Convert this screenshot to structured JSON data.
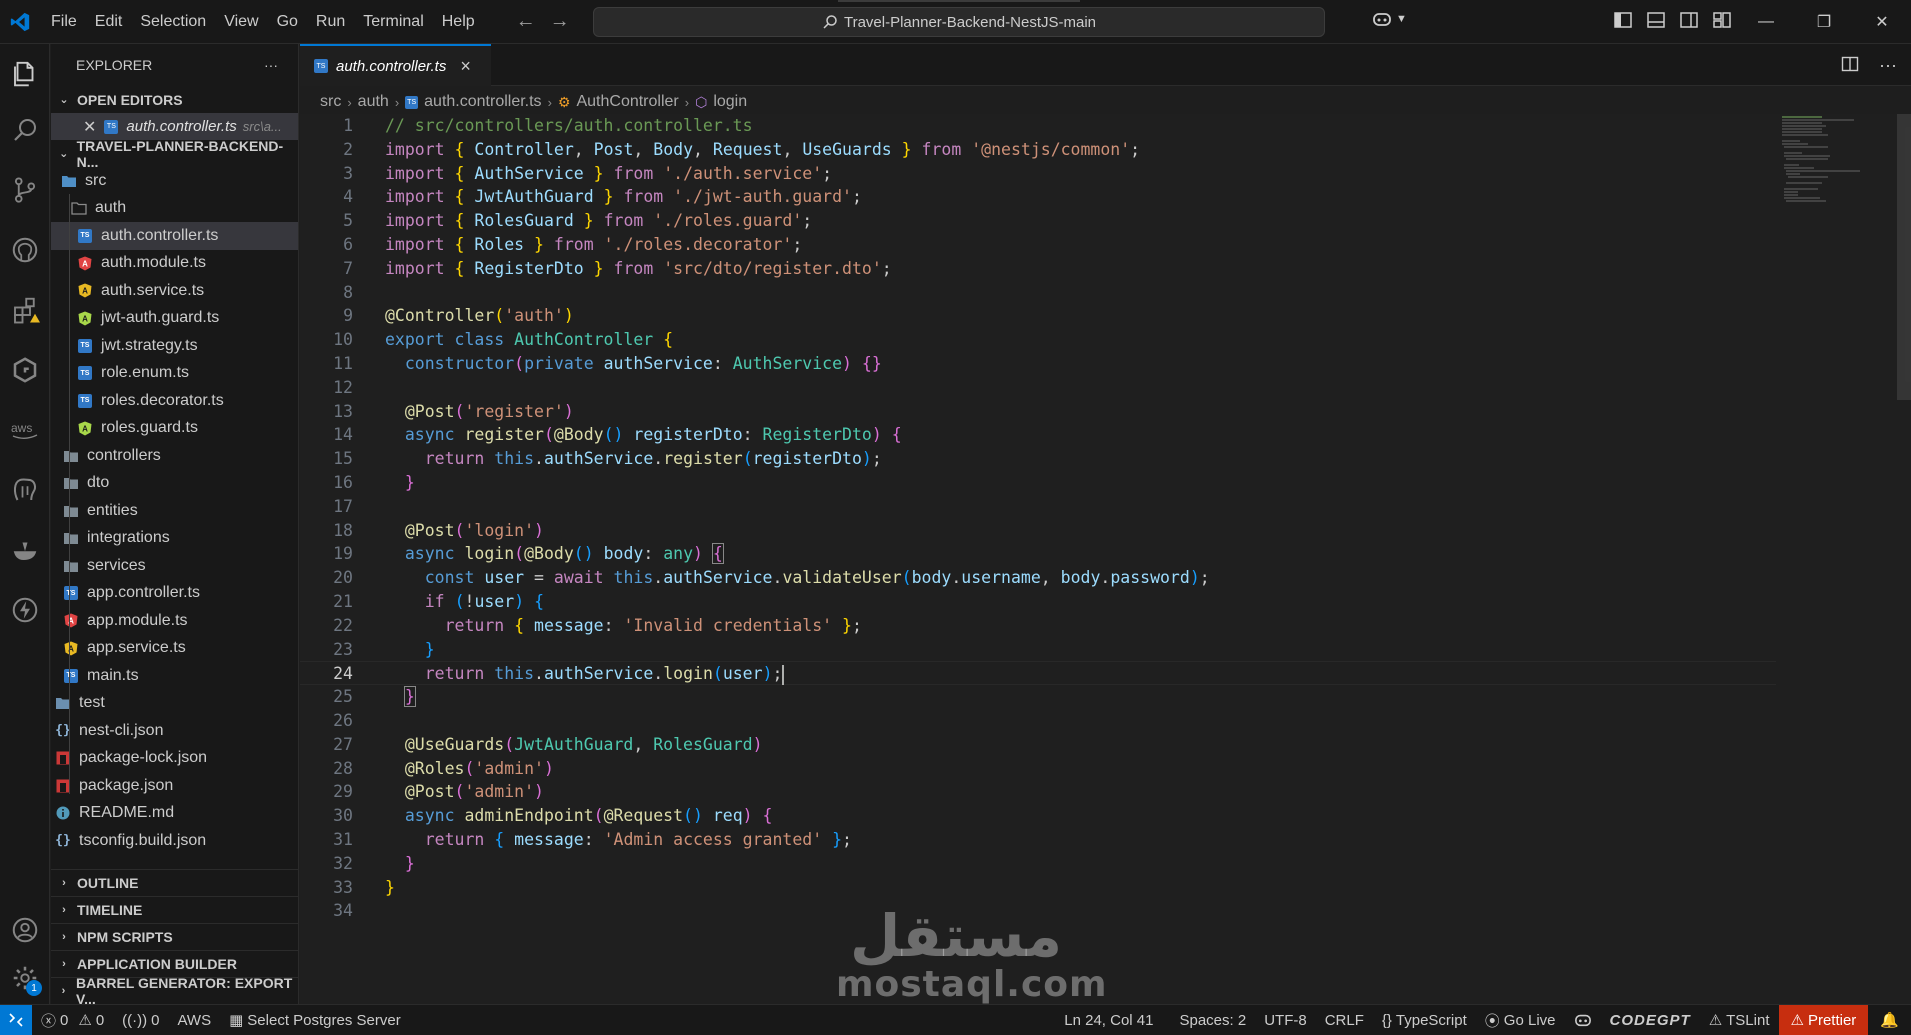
{
  "menu": [
    "File",
    "Edit",
    "Selection",
    "View",
    "Go",
    "Run",
    "Terminal",
    "Help"
  ],
  "search": {
    "text": "Travel-Planner-Backend-NestJS-main"
  },
  "explorer": {
    "title": "EXPLORER",
    "more": "···",
    "open_editors_label": "OPEN EDITORS",
    "open_editor": {
      "name": "auth.controller.ts",
      "path": "src\\a..."
    },
    "project_label": "TRAVEL-PLANNER-BACKEND-N...",
    "tree": [
      {
        "name": "src",
        "icon": "folder-src"
      },
      {
        "name": "auth",
        "icon": "folder-open"
      },
      {
        "name": "auth.controller.ts",
        "icon": "ts",
        "selected": true
      },
      {
        "name": "auth.module.ts",
        "icon": "angular"
      },
      {
        "name": "auth.service.ts",
        "icon": "angular-service"
      },
      {
        "name": "jwt-auth.guard.ts",
        "icon": "guard"
      },
      {
        "name": "jwt.strategy.ts",
        "icon": "ts"
      },
      {
        "name": "role.enum.ts",
        "icon": "ts"
      },
      {
        "name": "roles.decorator.ts",
        "icon": "ts"
      },
      {
        "name": "roles.guard.ts",
        "icon": "guard"
      },
      {
        "name": "controllers",
        "icon": "folder"
      },
      {
        "name": "dto",
        "icon": "folder"
      },
      {
        "name": "entities",
        "icon": "folder"
      },
      {
        "name": "integrations",
        "icon": "folder"
      },
      {
        "name": "services",
        "icon": "folder"
      },
      {
        "name": "app.controller.ts",
        "icon": "ts"
      },
      {
        "name": "app.module.ts",
        "icon": "angular"
      },
      {
        "name": "app.service.ts",
        "icon": "angular-service"
      },
      {
        "name": "main.ts",
        "icon": "ts"
      },
      {
        "name": "test",
        "icon": "folder-test"
      },
      {
        "name": "nest-cli.json",
        "icon": "json"
      },
      {
        "name": "package-lock.json",
        "icon": "npm"
      },
      {
        "name": "package.json",
        "icon": "npm"
      },
      {
        "name": "README.md",
        "icon": "info"
      },
      {
        "name": "tsconfig.build.json",
        "icon": "json"
      }
    ],
    "bottom_sections": [
      "OUTLINE",
      "TIMELINE",
      "NPM SCRIPTS",
      "APPLICATION BUILDER",
      "BARREL GENERATOR: EXPORT V..."
    ]
  },
  "tab": {
    "name": "auth.controller.ts",
    "close": "×"
  },
  "breadcrumb": [
    "src",
    "auth",
    "auth.controller.ts",
    "AuthController",
    "login"
  ],
  "editor": {
    "active_line": 24
  },
  "statusbar": {
    "errors": "0",
    "warnings": "0",
    "ports": "0",
    "aws": "AWS",
    "postgres": "Select Postgres Server",
    "position": "Ln 24, Col 41",
    "spaces": "Spaces: 2",
    "encoding": "UTF-8",
    "eol": "CRLF",
    "language": "TypeScript",
    "golive": "Go Live",
    "codegpt": "CODEGPT",
    "tslint": "TSLint",
    "prettier": "Prettier"
  },
  "activity_badge": "1",
  "watermark": {
    "arabic": "مستقل",
    "latin": "mostaql.com"
  }
}
